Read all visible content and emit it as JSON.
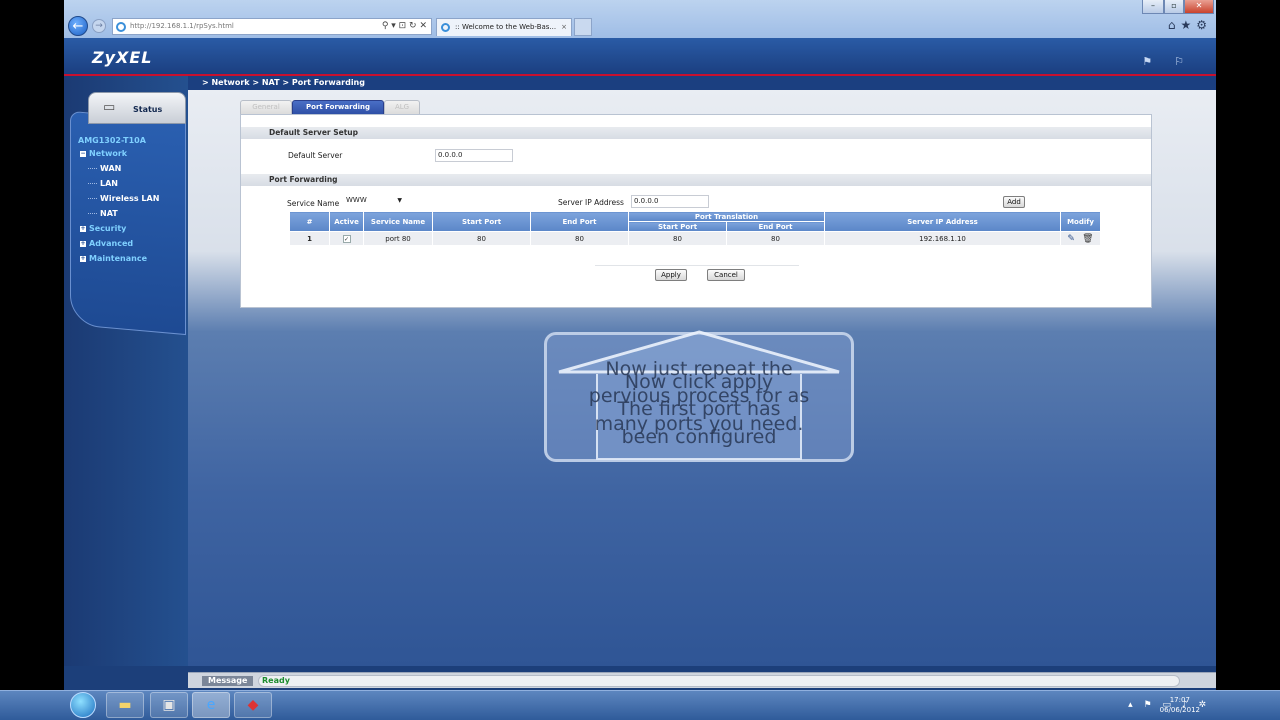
{
  "browser": {
    "url": "http://192.168.1.1/rpSys.html",
    "tab_title": ":: Welcome to the Web-Bas...",
    "window_controls": [
      "–",
      "▫",
      "✕"
    ]
  },
  "header": {
    "logo": "ZyXEL"
  },
  "breadcrumb": "> Network > NAT > Port Forwarding",
  "sidebar": {
    "status_label": "Status",
    "device_name": "AMG1302-T10A",
    "items": [
      {
        "label": "Network"
      },
      {
        "label": "WAN"
      },
      {
        "label": "LAN"
      },
      {
        "label": "Wireless LAN"
      },
      {
        "label": "NAT"
      },
      {
        "label": "Security"
      },
      {
        "label": "Advanced"
      },
      {
        "label": "Maintenance"
      }
    ]
  },
  "tabs": [
    {
      "label": "General"
    },
    {
      "label": "Port Forwarding"
    },
    {
      "label": "ALG"
    }
  ],
  "default_server": {
    "section_title": "Default Server Setup",
    "label": "Default Server",
    "value": "0.0.0.0"
  },
  "port_forwarding": {
    "section_title": "Port Forwarding",
    "service_name_label": "Service Name",
    "service_name_value": "WWW",
    "server_ip_label": "Server IP Address",
    "server_ip_value": "0.0.0.0",
    "add_label": "Add",
    "columns": {
      "num": "#",
      "active": "Active",
      "service": "Service Name",
      "start": "Start Port",
      "end": "End Port",
      "translation": "Port Translation",
      "t_start": "Start Port",
      "t_end": "End Port",
      "server_ip": "Server IP Address",
      "modify": "Modify"
    },
    "rows": [
      {
        "num": "1",
        "active": "✓",
        "service": "port 80",
        "start": "80",
        "end": "80",
        "t_start": "80",
        "t_end": "80",
        "server_ip": "192.168.1.10"
      }
    ],
    "apply_label": "Apply",
    "cancel_label": "Cancel"
  },
  "overlay": {
    "line1": "Now just repeat the",
    "line2": "Now click apply",
    "line3": "pervious process for as",
    "line4": "The first port has",
    "line5": "many ports you need.",
    "line6": "been configured"
  },
  "message_bar": {
    "label": "Message",
    "status": "Ready"
  },
  "taskbar": {
    "time": "17:07",
    "date": "06/06/2012"
  }
}
